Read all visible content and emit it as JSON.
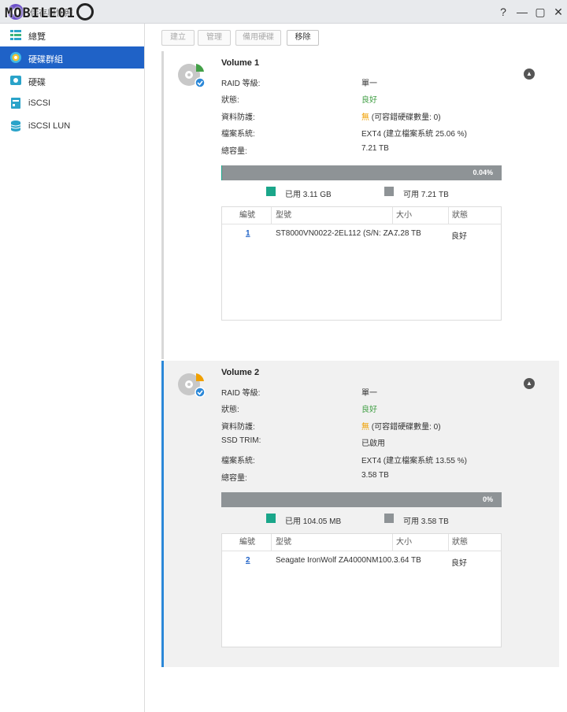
{
  "window": {
    "title": "儲存與快照",
    "watermark": "MOBILE01",
    "controls": [
      "?",
      "—",
      "▢",
      "✕"
    ]
  },
  "sidebar": {
    "items": [
      {
        "label": "總覽",
        "icon": "overview-icon",
        "active": false
      },
      {
        "label": "硬碟群組",
        "icon": "disk-group-icon",
        "active": true
      },
      {
        "label": "硬碟",
        "icon": "disk-icon",
        "active": false
      },
      {
        "label": "iSCSI",
        "icon": "iscsi-icon",
        "active": false
      },
      {
        "label": "iSCSI LUN",
        "icon": "iscsi-lun-icon",
        "active": false
      }
    ]
  },
  "toolbar": {
    "create": "建立",
    "manage": "管理",
    "spare": "備用硬碟",
    "remove": "移除"
  },
  "colors": {
    "accent": "#1f62c7",
    "used": "#1aa68a",
    "free": "#8e9396",
    "status_good": "#43a047",
    "warning": "#f0a000"
  },
  "volumes": [
    {
      "name": "Volume 1",
      "rows": [
        {
          "label": "RAID 等級:",
          "value": "單一"
        },
        {
          "label": "狀態:",
          "value": "良好"
        },
        {
          "label": "資料防護:",
          "value_prefix": "無",
          "value": " (可容錯硬碟數量: 0)"
        },
        {
          "label": "檔案系統:",
          "value": "EXT4 (建立檔案系統 25.06 %)"
        },
        {
          "label": "總容量:",
          "value": "7.21 TB"
        }
      ],
      "usage_percent": "0.04%",
      "used_fraction": 0.0004,
      "legend_used": "已用 3.11 GB",
      "legend_free": "可用 7.21 TB",
      "table": {
        "headers": [
          "編號",
          "型號",
          "大小",
          "狀態"
        ],
        "rows": [
          {
            "num": "1",
            "model": "ST8000VN0022-2EL112 (S/N: ZA...",
            "size": "7.28 TB",
            "status": "良好"
          }
        ]
      }
    },
    {
      "name": "Volume 2",
      "rows": [
        {
          "label": "RAID 等級:",
          "value": "單一"
        },
        {
          "label": "狀態:",
          "value": "良好"
        },
        {
          "label": "資料防護:",
          "value_prefix": "無",
          "value": " (可容錯硬碟數量: 0)"
        },
        {
          "label": "SSD TRIM:",
          "value": "已啟用"
        },
        {
          "label": "檔案系統:",
          "value": "EXT4 (建立檔案系統 13.55 %)"
        },
        {
          "label": "總容量:",
          "value": "3.58 TB"
        }
      ],
      "usage_percent": "0%",
      "used_fraction": 0,
      "legend_used": "已用 104.05 MB",
      "legend_free": "可用 3.58 TB",
      "table": {
        "headers": [
          "編號",
          "型號",
          "大小",
          "狀態"
        ],
        "rows": [
          {
            "num": "2",
            "model": "Seagate IronWolf ZA4000NM100...",
            "size": "3.64 TB",
            "status": "良好"
          }
        ]
      }
    }
  ]
}
